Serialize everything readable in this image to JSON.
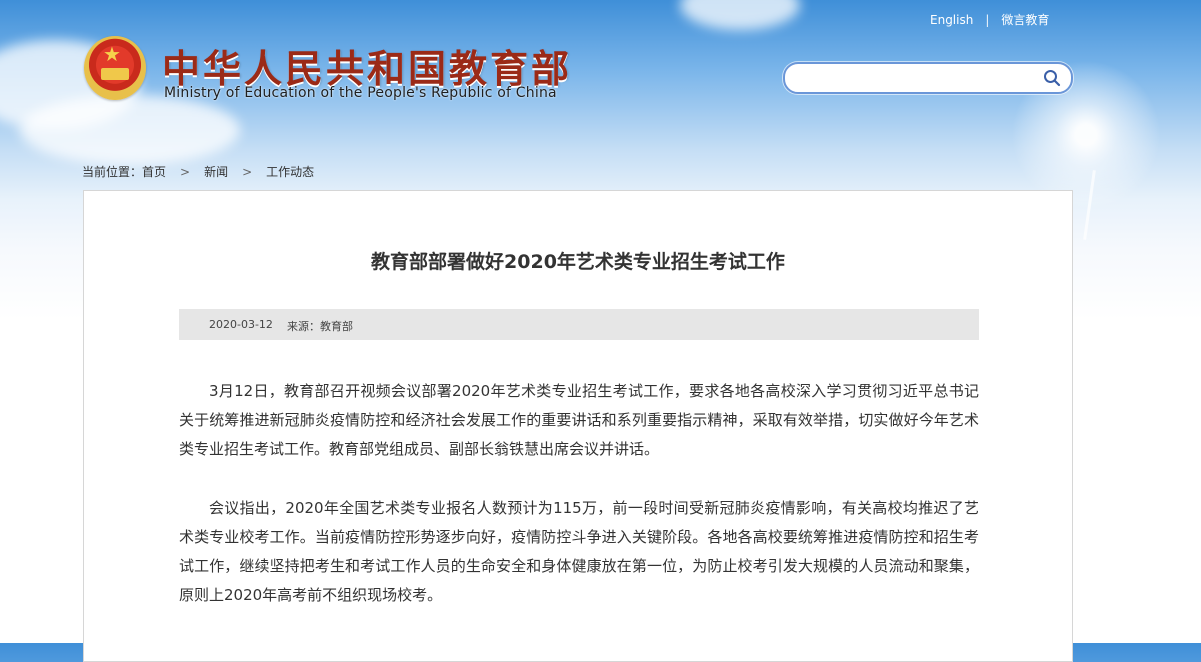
{
  "header": {
    "site_title": "中华人民共和国教育部",
    "site_subtitle": "Ministry of Education of the People's Republic of China",
    "links": {
      "english": "English",
      "separator": "|",
      "weiyan": "微言教育"
    },
    "search": {
      "placeholder": "",
      "icon": "search-icon"
    }
  },
  "breadcrumb": {
    "prefix": "当前位置：",
    "items": [
      "首页",
      "新闻",
      "工作动态"
    ],
    "separator": ">"
  },
  "article": {
    "title": "教育部部署做好2020年艺术类专业招生考试工作",
    "date": "2020-03-12",
    "source": "来源：教育部",
    "paragraphs": [
      "3月12日，教育部召开视频会议部署2020年艺术类专业招生考试工作，要求各地各高校深入学习贯彻习近平总书记关于统筹推进新冠肺炎疫情防控和经济社会发展工作的重要讲话和系列重要指示精神，采取有效举措，切实做好今年艺术类专业招生考试工作。教育部党组成员、副部长翁铁慧出席会议并讲话。",
      "会议指出，2020年全国艺术类专业报名人数预计为115万，前一段时间受新冠肺炎疫情影响，有关高校均推迟了艺术类专业校考工作。当前疫情防控形势逐步向好，疫情防控斗争进入关键阶段。各地各高校要统筹推进疫情防控和招生考试工作，继续坚持把考生和考试工作人员的生命安全和身体健康放在第一位，为防止校考引发大规模的人员流动和聚集，原则上2020年高考前不组织现场校考。"
    ]
  },
  "colors": {
    "title": "#9b2a17",
    "search_border": "#6a96d8",
    "meta_bg": "#e6e6e6"
  }
}
